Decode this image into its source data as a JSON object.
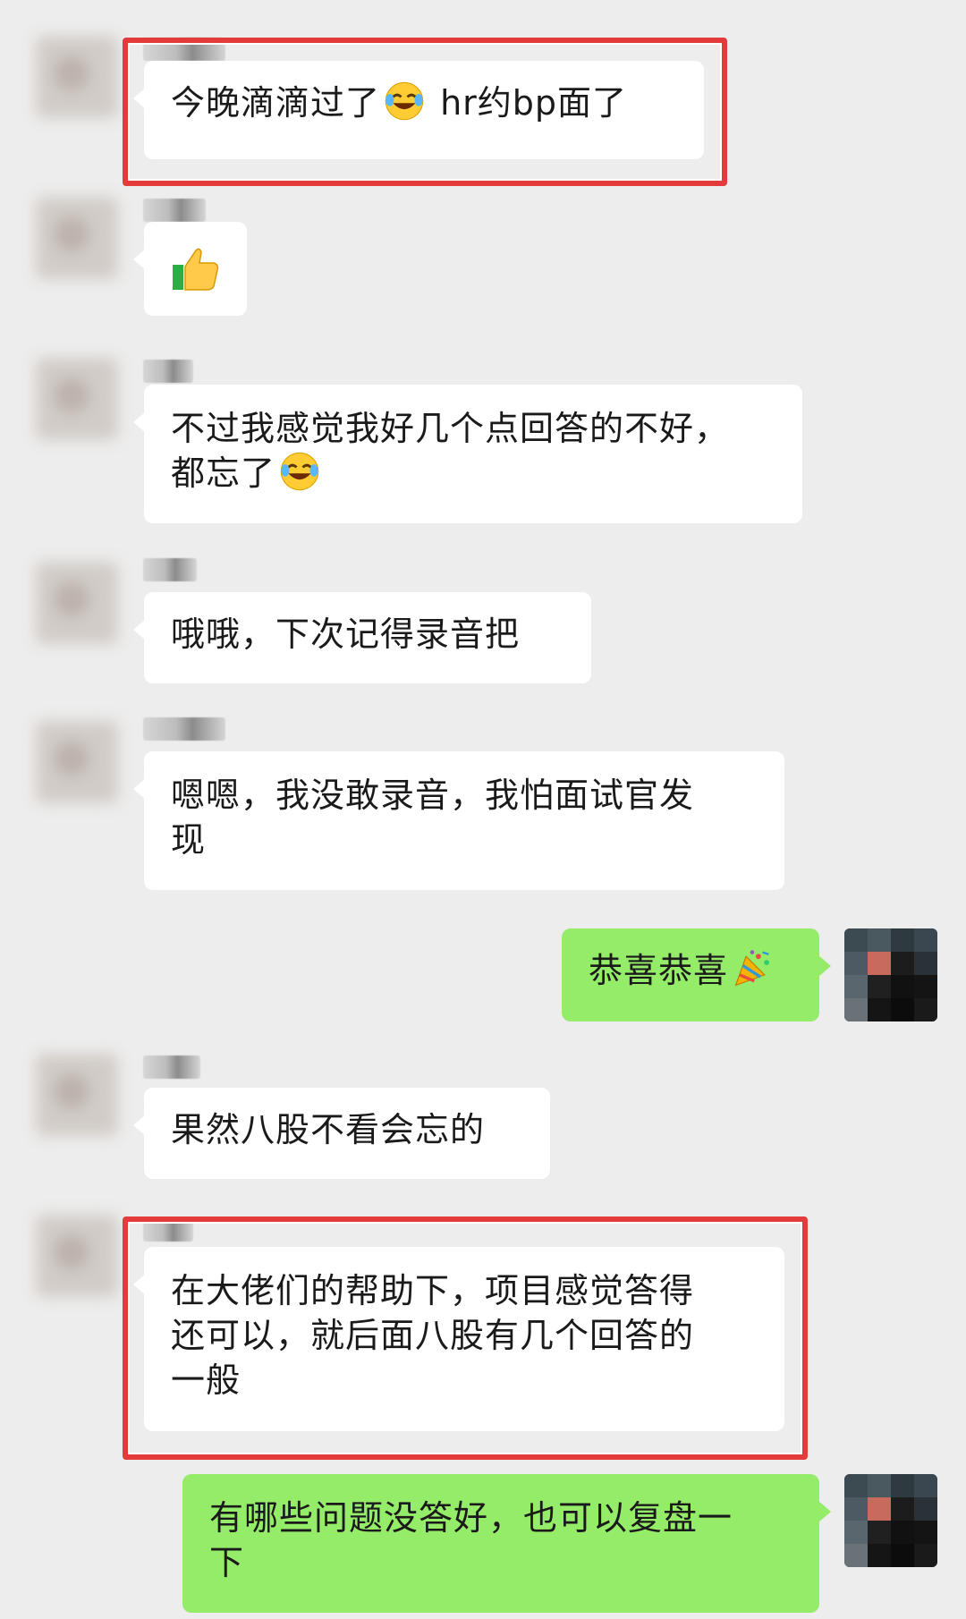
{
  "messages": [
    {
      "side": "left",
      "text": "今晚滴滴过了",
      "text_after": " hr约bp面了",
      "emoji": "laughing-tears"
    },
    {
      "side": "left",
      "emoji_only": "thumbs-up"
    },
    {
      "side": "left",
      "line1": "不过我感觉我好几个点回答的不好，",
      "line2": "都忘了"
    },
    {
      "side": "left",
      "text": "哦哦，下次记得录音把"
    },
    {
      "side": "left",
      "line1": "嗯嗯，我没敢录音，我怕面试官发",
      "line2": "现"
    },
    {
      "side": "right",
      "text": "恭喜恭喜",
      "emoji": "party-popper"
    },
    {
      "side": "left",
      "text": "果然八股不看会忘的"
    },
    {
      "side": "left",
      "line1": "在大佬们的帮助下，项目感觉答得",
      "line2": "还可以，就后面八股有几个回答的",
      "line3": "一般"
    },
    {
      "side": "right",
      "line1": "有哪些问题没答好，也可以复盘一",
      "line2": "下"
    }
  ],
  "colors": {
    "background": "#ededed",
    "bubble_left": "#ffffff",
    "bubble_right": "#95ec69",
    "highlight": "#e33b3b"
  },
  "icons": [
    "avatar",
    "laughing-tears-emoji",
    "thumbs-up-emoji",
    "party-popper-emoji"
  ]
}
